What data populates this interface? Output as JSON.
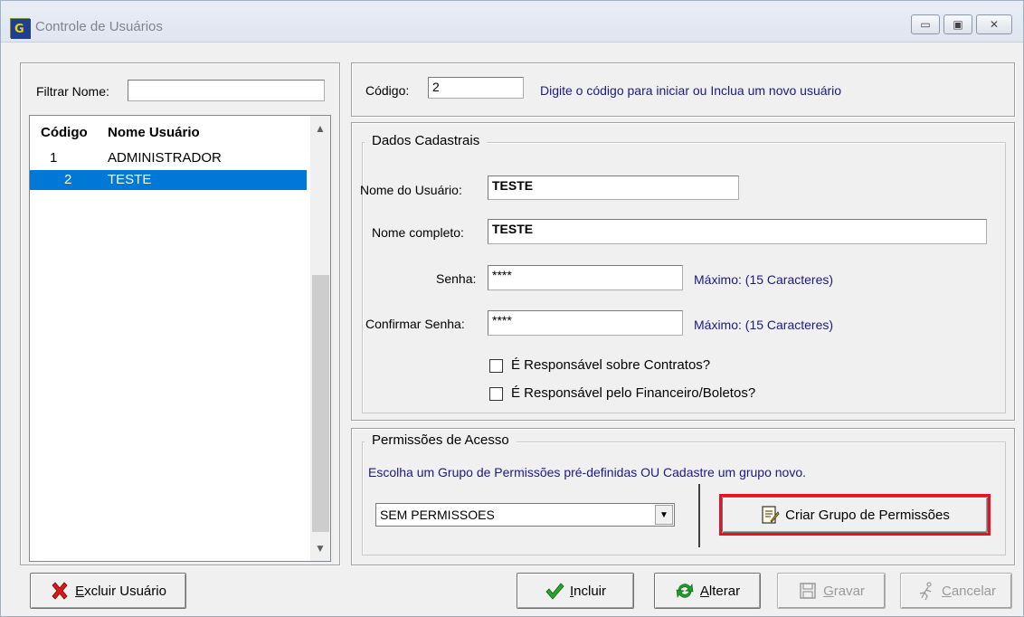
{
  "window": {
    "title": "Controle de Usuários",
    "controls": [
      "minimize",
      "restore",
      "close"
    ]
  },
  "filter": {
    "label": "Filtrar Nome:",
    "value": ""
  },
  "user_list": {
    "columns": [
      "Código",
      "Nome Usuário"
    ],
    "rows": [
      {
        "code": "1",
        "name": "ADMINISTRADOR",
        "selected": false
      },
      {
        "code": "2",
        "name": "TESTE",
        "selected": true
      }
    ]
  },
  "code_section": {
    "label": "Código:",
    "value": "2",
    "hint": "Digite o código para iniciar ou Inclua um novo usuário"
  },
  "dados": {
    "legend": "Dados Cadastrais",
    "username_label": "Nome do Usuário:",
    "username_value": "TESTE",
    "fullname_label": "Nome completo:",
    "fullname_value": "TESTE",
    "password_label": "Senha:",
    "password_value": "****",
    "password_hint": "Máximo: (15 Caracteres)",
    "confirm_label": "Confirmar Senha:",
    "confirm_value": "****",
    "confirm_hint": "Máximo: (15 Caracteres)",
    "check_contracts_label": "É Responsável sobre Contratos?",
    "check_contracts_checked": false,
    "check_finance_label": "É Responsável pelo Financeiro/Boletos?",
    "check_finance_checked": false
  },
  "permissions": {
    "legend": "Permissões de Acesso",
    "instruction": "Escolha um Grupo de Permissões pré-definidas OU Cadastre um grupo novo.",
    "selected_group": "SEM PERMISSOES",
    "create_group_label": "Criar Grupo de Permissões"
  },
  "buttons": {
    "delete_user": {
      "accel": "E",
      "rest": "xcluir Usuário",
      "icon": "red-x-icon",
      "enabled": true
    },
    "include": {
      "accel": "I",
      "rest": "ncluir",
      "icon": "green-check-icon",
      "enabled": true
    },
    "alter": {
      "accel": "A",
      "rest": "lterar",
      "icon": "green-refresh-icon",
      "enabled": true
    },
    "save": {
      "accel": "G",
      "rest": "ravar",
      "icon": "floppy-disk-icon",
      "enabled": false
    },
    "cancel": {
      "accel": "C",
      "rest": "ancelar",
      "icon": "running-man-icon",
      "enabled": false
    }
  },
  "colors": {
    "selection": "#0078d7",
    "highlight_border": "#e81123",
    "hint_text": "#1a1a80"
  }
}
